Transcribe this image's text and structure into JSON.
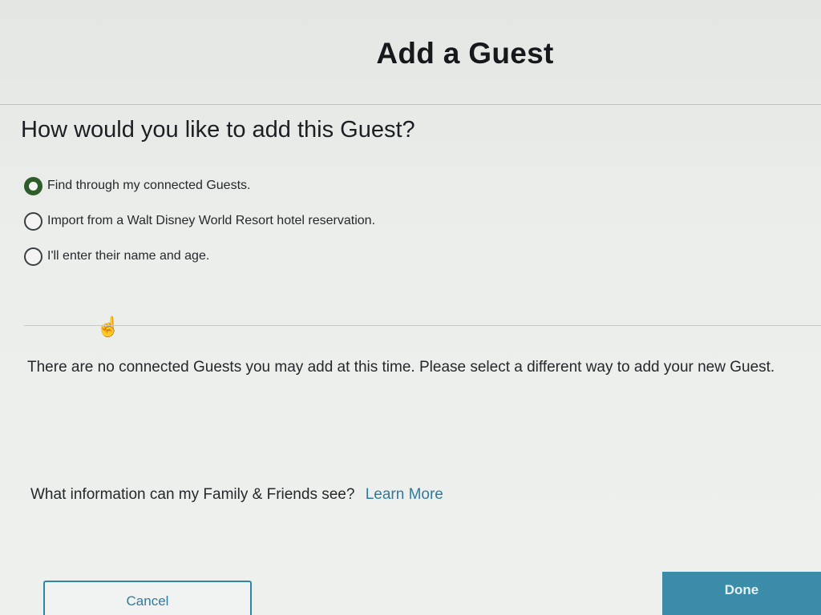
{
  "modal": {
    "title": "Add a Guest"
  },
  "question": "How would you like to add this Guest?",
  "options": [
    {
      "label": "Find through my connected Guests.",
      "selected": true
    },
    {
      "label": "Import from a Walt Disney World Resort hotel reservation.",
      "selected": false
    },
    {
      "label": "I'll enter their name and age.",
      "selected": false
    }
  ],
  "message": "There are no connected Guests you may add at this time. Please select a different way to add your new Guest.",
  "info": {
    "question": "What information can my Family & Friends see?",
    "link": "Learn More"
  },
  "buttons": {
    "cancel": "Cancel",
    "done": "Done"
  },
  "colors": {
    "selected_radio": "#2e5c2a",
    "accent": "#2f7b9e",
    "done_button": "#3a8ca8"
  },
  "icons": {
    "cursor": "hand-pointer-icon"
  }
}
